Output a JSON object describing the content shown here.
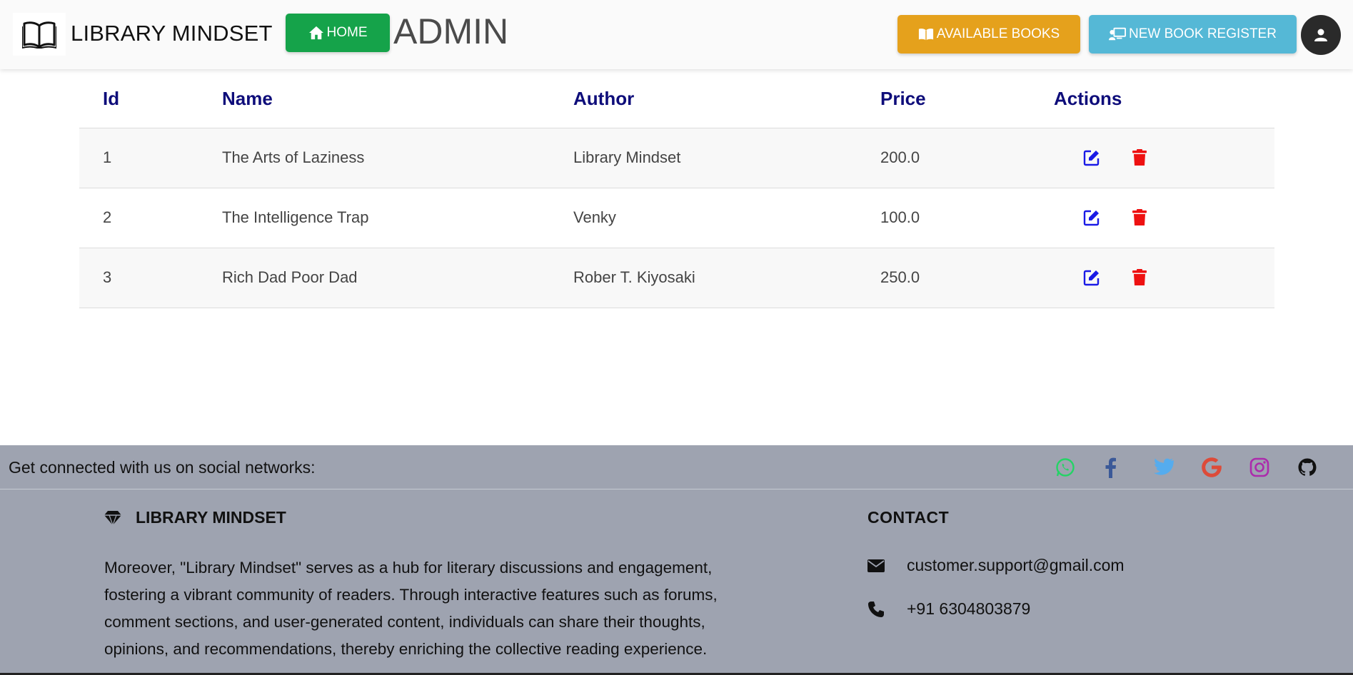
{
  "navbar": {
    "brand": "LIBRARY MINDSET",
    "home_label": "HOME",
    "admin_title": "ADMIN",
    "available_books_label": "AVAILABLE BOOKS",
    "new_book_register_label": "NEW BOOK REGISTER"
  },
  "colors": {
    "home": "#15a34a",
    "available": "#e5a11c",
    "register": "#55b8d6",
    "header_text": "#0e0d7a",
    "edit": "#1a1ae6",
    "delete": "#ee1111"
  },
  "table": {
    "headers": [
      "Id",
      "Name",
      "Author",
      "Price",
      "Actions"
    ],
    "rows": [
      {
        "id": "1",
        "name": "The Arts of Laziness",
        "author": "Library Mindset",
        "price": "200.0"
      },
      {
        "id": "2",
        "name": "The Intelligence Trap",
        "author": "Venky",
        "price": "100.0"
      },
      {
        "id": "3",
        "name": "Rich Dad Poor Dad",
        "author": "Rober T. Kiyosaki",
        "price": "250.0"
      }
    ]
  },
  "footer": {
    "social_text": "Get connected with us on social networks:",
    "social_icons": [
      "whatsapp-icon",
      "facebook-icon",
      "twitter-icon",
      "google-icon",
      "instagram-icon",
      "github-icon"
    ],
    "brand": "LIBRARY MINDSET",
    "description": "Moreover, \"Library Mindset\" serves as a hub for literary discussions and engagement, fostering a vibrant community of readers. Through interactive features such as forums, comment sections, and user-generated content, individuals can share their thoughts, opinions, and recommendations, thereby enriching the collective reading experience.",
    "contact_title": "CONTACT",
    "email": "customer.support@gmail.com",
    "phone": "+91 6304803879"
  }
}
